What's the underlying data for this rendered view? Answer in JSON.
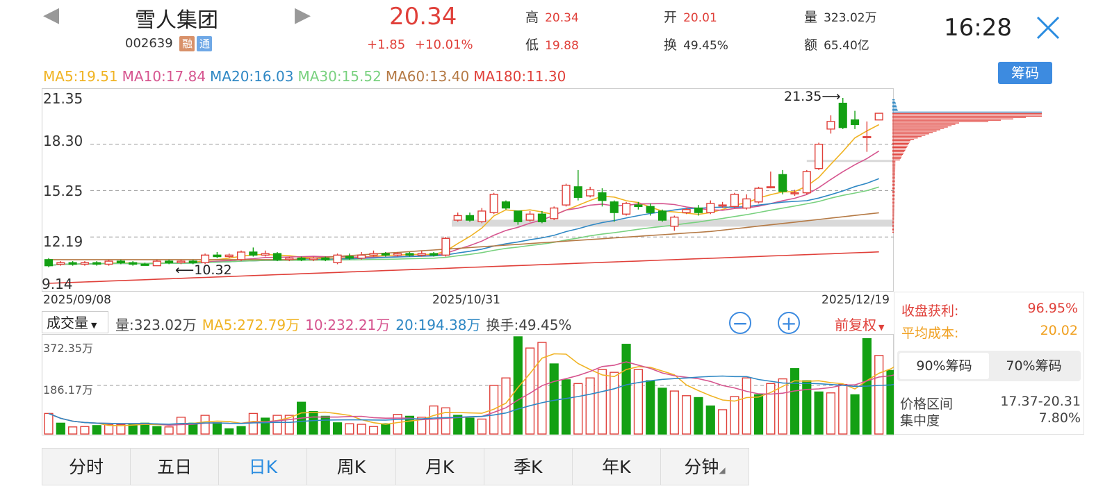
{
  "header": {
    "stock_name": "雪人集团",
    "stock_code": "002639",
    "badge_rong": "融",
    "badge_tong": "通",
    "price": "20.34",
    "change": "+1.85",
    "change_pct": "+10.01%",
    "high_label": "高",
    "high": "20.34",
    "low_label": "低",
    "low": "19.88",
    "open_label": "开",
    "open": "20.01",
    "turnover_label": "换",
    "turnover": "49.45%",
    "volume_label": "量",
    "volume": "323.02万",
    "amount_label": "额",
    "amount": "65.40亿",
    "time": "16:28"
  },
  "ma": {
    "ma5": "MA5:19.51",
    "ma10": "MA10:17.84",
    "ma20": "MA20:16.03",
    "ma30": "MA30:15.52",
    "ma60": "MA60:13.40",
    "ma180": "MA180:11.30"
  },
  "chip_button": "筹码",
  "price_axis": [
    "21.35",
    "18.30",
    "15.25",
    "12.19",
    "9.14"
  ],
  "annotations": {
    "high_mark": "21.35",
    "low_mark": "10.32"
  },
  "date_axis": [
    "2025/09/08",
    "2025/10/31",
    "2025/12/19"
  ],
  "volume_bar": {
    "selector": "成交量",
    "vol": "量:323.02万",
    "ma5": "MA5:272.79万",
    "ma10": "10:232.21万",
    "ma20": "20:194.38万",
    "turnover": "换手:49.45%",
    "adjust": "前复权"
  },
  "volume_axis": [
    "372.35万",
    "186.17万"
  ],
  "side_panel": {
    "profit_label": "收盘获利:",
    "profit": "96.95%",
    "cost_label": "平均成本:",
    "cost": "20.02",
    "tab90": "90%筹码",
    "tab70": "70%筹码",
    "range_label": "价格区间",
    "range": "17.37-20.31",
    "conc_label": "集中度",
    "conc": "7.80%"
  },
  "bottom_tabs": [
    "分时",
    "五日",
    "日K",
    "周K",
    "月K",
    "季K",
    "年K",
    "分钟"
  ],
  "colors": {
    "up": "#e0403a",
    "down": "#13a013",
    "ma5": "#f0b323",
    "ma10": "#d6558f",
    "ma20": "#2f88c4",
    "ma30": "#79d17f",
    "ma60": "#b57a45",
    "ma180": "#e0403a"
  },
  "chart_data": {
    "type": "candlestick",
    "x_start": "2025/09/08",
    "x_mid": "2025/10/31",
    "x_end": "2025/12/19",
    "ylim": [
      9.14,
      21.35
    ],
    "candles": [
      [
        10.7,
        10.3,
        10.8,
        10.2
      ],
      [
        10.4,
        10.5,
        10.6,
        10.3
      ],
      [
        10.5,
        10.4,
        10.6,
        10.3
      ],
      [
        10.4,
        10.5,
        10.6,
        10.3
      ],
      [
        10.5,
        10.4,
        10.6,
        10.3
      ],
      [
        10.4,
        10.6,
        10.7,
        10.3
      ],
      [
        10.6,
        10.5,
        10.7,
        10.4
      ],
      [
        10.5,
        10.4,
        10.6,
        10.3
      ],
      [
        10.4,
        10.32,
        10.5,
        10.32
      ],
      [
        10.3,
        10.6,
        10.7,
        10.3
      ],
      [
        10.6,
        10.5,
        10.7,
        10.4
      ],
      [
        10.5,
        10.6,
        10.7,
        10.4
      ],
      [
        10.6,
        10.5,
        10.7,
        10.4
      ],
      [
        10.5,
        11.0,
        11.1,
        10.4
      ],
      [
        11.0,
        10.9,
        11.2,
        10.8
      ],
      [
        10.9,
        11.0,
        11.1,
        10.8
      ],
      [
        10.7,
        11.2,
        11.3,
        10.6
      ],
      [
        11.2,
        11.0,
        11.5,
        10.9
      ],
      [
        11.0,
        11.1,
        11.3,
        10.9
      ],
      [
        11.1,
        10.7,
        11.2,
        10.6
      ],
      [
        10.7,
        10.8,
        10.9,
        10.6
      ],
      [
        10.8,
        10.7,
        10.9,
        10.6
      ],
      [
        10.7,
        10.8,
        10.9,
        10.6
      ],
      [
        10.8,
        10.7,
        10.9,
        10.6
      ],
      [
        10.5,
        11.0,
        11.1,
        10.4
      ],
      [
        10.9,
        10.8,
        11.1,
        10.7
      ],
      [
        10.8,
        11.0,
        11.2,
        10.7
      ],
      [
        11.0,
        11.1,
        11.3,
        10.9
      ],
      [
        11.1,
        11.0,
        11.2,
        10.9
      ],
      [
        11.0,
        11.1,
        11.2,
        10.9
      ],
      [
        11.1,
        11.0,
        11.2,
        10.9
      ],
      [
        11.0,
        11.1,
        11.3,
        10.9
      ],
      [
        11.1,
        11.0,
        11.2,
        10.9
      ],
      [
        11.0,
        12.1,
        12.2,
        10.9
      ],
      [
        13.3,
        13.6,
        13.8,
        13.2
      ],
      [
        13.6,
        13.3,
        13.8,
        13.2
      ],
      [
        13.2,
        13.9,
        14.1,
        13.1
      ],
      [
        13.8,
        15.0,
        15.1,
        13.7
      ],
      [
        14.5,
        14.1,
        14.6,
        14.0
      ],
      [
        13.9,
        13.2,
        13.8,
        13.0
      ],
      [
        13.3,
        13.7,
        13.9,
        13.2
      ],
      [
        13.7,
        13.2,
        13.9,
        13.1
      ],
      [
        13.4,
        14.1,
        14.2,
        13.3
      ],
      [
        14.3,
        15.6,
        15.7,
        14.2
      ],
      [
        15.5,
        14.8,
        16.6,
        14.6
      ],
      [
        14.9,
        15.3,
        15.5,
        14.8
      ],
      [
        15.1,
        14.6,
        15.4,
        14.2
      ],
      [
        14.5,
        13.8,
        14.6,
        13.2
      ],
      [
        13.7,
        14.4,
        14.5,
        13.6
      ],
      [
        14.3,
        14.2,
        14.5,
        14.0
      ],
      [
        14.2,
        13.8,
        14.4,
        13.6
      ],
      [
        13.9,
        13.3,
        14.0,
        13.2
      ],
      [
        12.9,
        13.5,
        13.6,
        12.6
      ],
      [
        13.8,
        14.0,
        14.1,
        13.7
      ],
      [
        14.1,
        13.8,
        14.3,
        13.6
      ],
      [
        13.8,
        14.4,
        14.6,
        13.7
      ],
      [
        14.3,
        14.3,
        14.5,
        14.1
      ],
      [
        14.2,
        15.0,
        15.1,
        14.1
      ],
      [
        14.1,
        14.7,
        15.0,
        14.0
      ],
      [
        14.5,
        15.4,
        15.5,
        14.4
      ],
      [
        15.5,
        15.5,
        16.5,
        15.4
      ],
      [
        16.3,
        15.2,
        16.6,
        15.0
      ],
      [
        15.1,
        15.1,
        15.3,
        14.9
      ],
      [
        15.1,
        16.5,
        16.6,
        15.0
      ],
      [
        16.7,
        18.3,
        18.4,
        16.6
      ],
      [
        19.3,
        19.8,
        20.2,
        19.0
      ],
      [
        21.0,
        19.4,
        21.35,
        19.3
      ],
      [
        19.9,
        19.6,
        20.5,
        19.3
      ],
      [
        18.8,
        18.8,
        19.8,
        17.8
      ],
      [
        19.9,
        20.34,
        20.34,
        19.88
      ]
    ],
    "volume": [
      [
        110,
        "up"
      ],
      [
        58,
        "down"
      ],
      [
        38,
        "up"
      ],
      [
        40,
        "up"
      ],
      [
        45,
        "down"
      ],
      [
        50,
        "up"
      ],
      [
        50,
        "up"
      ],
      [
        55,
        "down"
      ],
      [
        58,
        "down"
      ],
      [
        40,
        "down"
      ],
      [
        38,
        "up"
      ],
      [
        90,
        "up"
      ],
      [
        58,
        "down"
      ],
      [
        100,
        "up"
      ],
      [
        60,
        "down"
      ],
      [
        28,
        "down"
      ],
      [
        40,
        "down"
      ],
      [
        110,
        "up"
      ],
      [
        85,
        "down"
      ],
      [
        100,
        "up"
      ],
      [
        100,
        "up"
      ],
      [
        170,
        "down"
      ],
      [
        120,
        "down"
      ],
      [
        95,
        "down"
      ],
      [
        60,
        "down"
      ],
      [
        55,
        "up"
      ],
      [
        52,
        "up"
      ],
      [
        40,
        "up"
      ],
      [
        55,
        "down"
      ],
      [
        105,
        "up"
      ],
      [
        95,
        "down"
      ],
      [
        90,
        "up"
      ],
      [
        150,
        "up"
      ],
      [
        140,
        "up"
      ],
      [
        100,
        "down"
      ],
      [
        85,
        "down"
      ],
      [
        80,
        "up"
      ],
      [
        260,
        "up"
      ],
      [
        300,
        "up"
      ],
      [
        520,
        "down"
      ],
      [
        460,
        "up"
      ],
      [
        490,
        "up"
      ],
      [
        375,
        "down"
      ],
      [
        290,
        "down"
      ],
      [
        270,
        "up"
      ],
      [
        300,
        "up"
      ],
      [
        345,
        "up"
      ],
      [
        330,
        "up"
      ],
      [
        480,
        "down"
      ],
      [
        345,
        "up"
      ],
      [
        285,
        "down"
      ],
      [
        245,
        "down"
      ],
      [
        230,
        "up"
      ],
      [
        205,
        "up"
      ],
      [
        195,
        "down"
      ],
      [
        150,
        "down"
      ],
      [
        130,
        "up"
      ],
      [
        200,
        "up"
      ],
      [
        300,
        "up"
      ],
      [
        210,
        "down"
      ],
      [
        270,
        "up"
      ],
      [
        295,
        "up"
      ],
      [
        350,
        "down"
      ],
      [
        285,
        "down"
      ],
      [
        225,
        "down"
      ],
      [
        220,
        "up"
      ],
      [
        265,
        "up"
      ],
      [
        210,
        "down"
      ],
      [
        510,
        "down"
      ],
      [
        420,
        "up"
      ],
      [
        340,
        "down"
      ],
      [
        465,
        "up"
      ]
    ]
  }
}
